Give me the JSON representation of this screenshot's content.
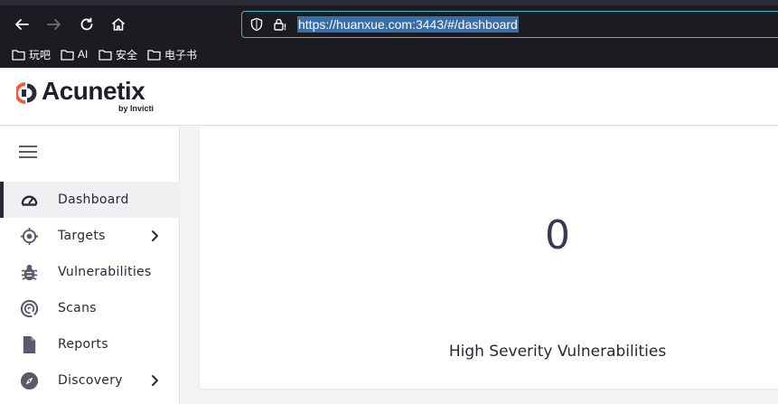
{
  "browser": {
    "url": "https://huanxue.com:3443/#/dashboard",
    "bookmarks": [
      {
        "label": "玩吧",
        "icon": "folder-icon"
      },
      {
        "label": "AI",
        "icon": "folder-icon"
      },
      {
        "label": "安全",
        "icon": "folder-icon"
      },
      {
        "label": "电子书",
        "icon": "folder-icon"
      }
    ]
  },
  "header": {
    "brand": "Acunetix",
    "brand_sub": "by Invicti"
  },
  "sidebar": {
    "items": [
      {
        "label": "Dashboard",
        "icon": "gauge-icon",
        "active": true
      },
      {
        "label": "Targets",
        "icon": "crosshair-icon",
        "has_submenu": true
      },
      {
        "label": "Vulnerabilities",
        "icon": "bug-icon"
      },
      {
        "label": "Scans",
        "icon": "radar-icon"
      },
      {
        "label": "Reports",
        "icon": "document-icon"
      },
      {
        "label": "Discovery",
        "icon": "compass-icon",
        "has_submenu": true
      }
    ]
  },
  "dashboard": {
    "high_severity_count": "0",
    "high_severity_label": "High Severity Vulnerabilities"
  },
  "colors": {
    "browser_bg": "#1c1b22",
    "url_focus_border": "#3fb8d0",
    "text_dark": "#2a2838",
    "accent_orange": "#e8623a"
  }
}
